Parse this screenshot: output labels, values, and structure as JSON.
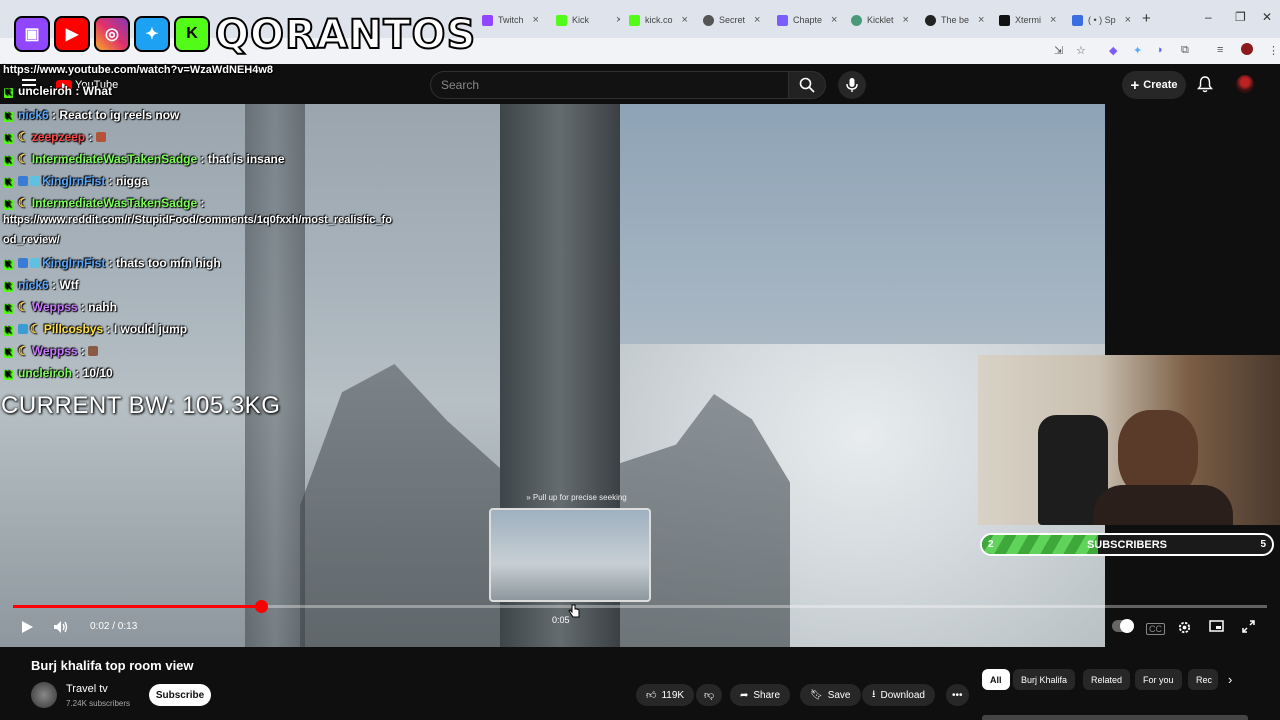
{
  "browser": {
    "tabs": [
      {
        "label": "Twitch",
        "color": "#9146ff"
      },
      {
        "label": "Kick",
        "color": "#53fc18"
      },
      {
        "label": "kick.co",
        "color": "#53fc18"
      },
      {
        "label": "Secret",
        "color": "#555555"
      },
      {
        "label": "Chapte",
        "color": "#7a5cff"
      },
      {
        "label": "Kicklet",
        "color": "#4a9a7a"
      },
      {
        "label": "The be",
        "color": "#222222"
      },
      {
        "label": "Xtermi",
        "color": "#111111"
      },
      {
        "label": "( • ) Sp",
        "color": "#3b6ee0"
      }
    ],
    "url": "https://www.youtube.com/watch?v=WzaWdNEH4w8"
  },
  "youtube": {
    "logo_text": "YouTube",
    "search_placeholder": "Search",
    "create_label": "Create"
  },
  "stream_overlay": {
    "logo_word": "QORANTOS",
    "chat": [
      {
        "user": "uncleiroh",
        "color": "#ffffff",
        "text": ": What"
      },
      {
        "user": "nick6",
        "color": "#5aa9ff",
        "text": ": React to ig reels now"
      },
      {
        "user": "zeepzeep",
        "color": "#ff4a4a",
        "text": ":"
      },
      {
        "user": "IntermediateWasTakenSadge",
        "color": "#7dff5a",
        "text": ": that is insane"
      },
      {
        "user": "KingIrnFist",
        "color": "#5aa9ff",
        "text": ": nigga"
      },
      {
        "user": "IntermediateWasTakenSadge",
        "color": "#7dff5a",
        "text": ":"
      },
      {
        "user": "",
        "color": "#ffffff",
        "text": "https://www.reddit.com/r/StupidFood/comments/1q0fxxh/most_realistic_fo"
      },
      {
        "user": "",
        "color": "#ffffff",
        "text": "od_review/"
      },
      {
        "user": "KingIrnFist",
        "color": "#5aa9ff",
        "text": ": thats too mfn high"
      },
      {
        "user": "nick6",
        "color": "#5aa9ff",
        "text": ": Wtf"
      },
      {
        "user": "Weppss",
        "color": "#c77dff",
        "text": ": nahh"
      },
      {
        "user": "Pillcosbys",
        "color": "#ffe14a",
        "text": ": I would jump"
      },
      {
        "user": "Weppss",
        "color": "#c77dff",
        "text": ":"
      },
      {
        "user": "uncleiroh",
        "color": "#7dff5a",
        "text": ": 10/10"
      }
    ],
    "bodyweight": "CURRENT BW: 105.3KG",
    "sub_goal": {
      "left": "2",
      "label": "SUBSCRIBERS",
      "right": "5",
      "progress": 0.4
    }
  },
  "player": {
    "seek_hint": "» Pull up for precise seeking",
    "preview_time": "0:05",
    "time_display": "0:02 / 0:13",
    "progress": 0.198
  },
  "video": {
    "title": "Burj khalifa top room view",
    "channel": "Travel tv",
    "subscribers": "7.24K subscribers",
    "subscribe_label": "Subscribe",
    "likes": "119K",
    "share_label": "Share",
    "save_label": "Save",
    "download_label": "Download"
  },
  "chips": [
    "All",
    "Burj Khalifa",
    "Related",
    "For you",
    "Rec"
  ]
}
